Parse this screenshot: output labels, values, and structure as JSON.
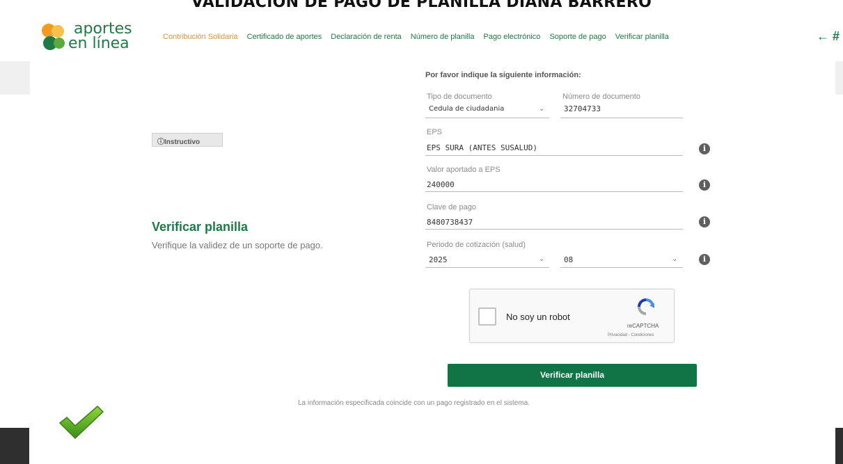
{
  "caption": "VALIDACIÓN DE PAGO DE PLANILLA DIANA BARRERO",
  "brand": {
    "line1": "aportes",
    "line2": "en línea"
  },
  "nav": {
    "items": [
      {
        "label": "Contribución Solidaria",
        "active": true
      },
      {
        "label": "Certificado de aportes",
        "active": false
      },
      {
        "label": "Declaración de renta",
        "active": false
      },
      {
        "label": "Número de planilla",
        "active": false
      },
      {
        "label": "Pago electrónico",
        "active": false
      },
      {
        "label": "Soporte de pago",
        "active": false
      },
      {
        "label": "Verificar planilla",
        "active": false
      }
    ],
    "arrows": "← #"
  },
  "instructivo": "Instructivo",
  "page": {
    "title": "Verificar planilla",
    "subtitle": "Verifique la validez de un soporte de pago."
  },
  "form": {
    "heading": "Por favor indique la siguiente información:",
    "tipo_documento": {
      "label": "Tipo de documento",
      "value": "Cedula de ciudadania"
    },
    "numero_documento": {
      "label": "Número de documento",
      "value": "32704733"
    },
    "eps": {
      "label": "EPS",
      "value": "EPS SURA (ANTES SUSALUD)"
    },
    "valor_aportado": {
      "label": "Valor aportado a EPS",
      "value": "240000"
    },
    "clave_pago": {
      "label": "Clave de pago",
      "value": "8480738437"
    },
    "periodo": {
      "label": "Periodo de cotización (salud)",
      "year": "2025",
      "month": "08"
    }
  },
  "captcha": {
    "label": "No soy un robot",
    "brand": "reCAPTCHA",
    "links": "Privacidad - Condiciones"
  },
  "verify_button": "Verificar planilla",
  "result": "La información especificada coincide con un pago registrado en el sistema.",
  "colors": {
    "primary": "#1e7a45",
    "button": "#117446",
    "accent": "#e8913a"
  }
}
